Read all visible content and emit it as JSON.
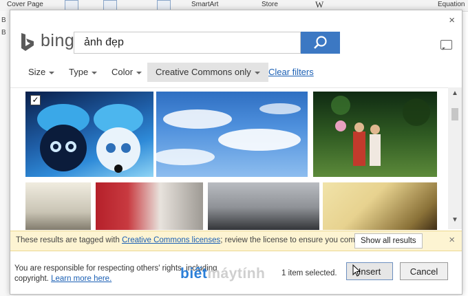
{
  "background_ribbon": {
    "items": [
      "Cover Page",
      "SmartArt",
      "Store",
      "W",
      "Equation"
    ],
    "left_letters": [
      "B",
      "B"
    ]
  },
  "dialog": {
    "close_glyph": "×",
    "brand": "bing",
    "search": {
      "value": "ảnh đẹp",
      "placeholder": ""
    },
    "filters": [
      {
        "label": "Size"
      },
      {
        "label": "Type"
      },
      {
        "label": "Color"
      },
      {
        "label": "Creative Commons only"
      }
    ],
    "clear_filters_label": "Clear filters",
    "results": [
      {
        "name": "cats-blue-hats",
        "selected": true,
        "colors": [
          "#0a1f4a",
          "#2e8ad8",
          "#8fd4f5"
        ]
      },
      {
        "name": "blue-sky-clouds",
        "selected": false,
        "colors": [
          "#3b7dd0",
          "#a9cdf1",
          "#ffffff"
        ]
      },
      {
        "name": "couple-forest",
        "selected": false,
        "colors": [
          "#1b3d1a",
          "#5c8a3a",
          "#c23a2c"
        ]
      },
      {
        "name": "wedding-window",
        "selected": false,
        "colors": [
          "#e9e4d6",
          "#9b9584",
          "#4a4740"
        ]
      },
      {
        "name": "wedding-red-flowers",
        "selected": false,
        "colors": [
          "#b5202a",
          "#e8e3dd",
          "#2c2c2c"
        ]
      },
      {
        "name": "black-car",
        "selected": false,
        "colors": [
          "#8f9297",
          "#2b2d30",
          "#cfd2d6"
        ]
      },
      {
        "name": "sunset-guitar",
        "selected": false,
        "colors": [
          "#e7d28f",
          "#8a7138",
          "#3a2a14"
        ]
      }
    ],
    "checkmark_glyph": "✓",
    "cc_notice": {
      "prefix": "These results are tagged with ",
      "link": "Creative Commons licenses",
      "suffix": "; review the license to ensure you comply.",
      "show_all_label": "Show all results",
      "close_glyph": "×"
    },
    "footer": {
      "responsibility_text": "You are responsible for respecting others' rights, including copyright. ",
      "learn_more_label": "Learn more here.",
      "selected_count": "1 item selected.",
      "insert_label": "Insert",
      "cancel_label": "Cancel"
    }
  },
  "watermark": {
    "part1": "biết",
    "part2": "máytính"
  },
  "colors": {
    "accent": "#3c78c3",
    "link": "#1a5fb4",
    "notice_bg": "#fdf4d2"
  }
}
